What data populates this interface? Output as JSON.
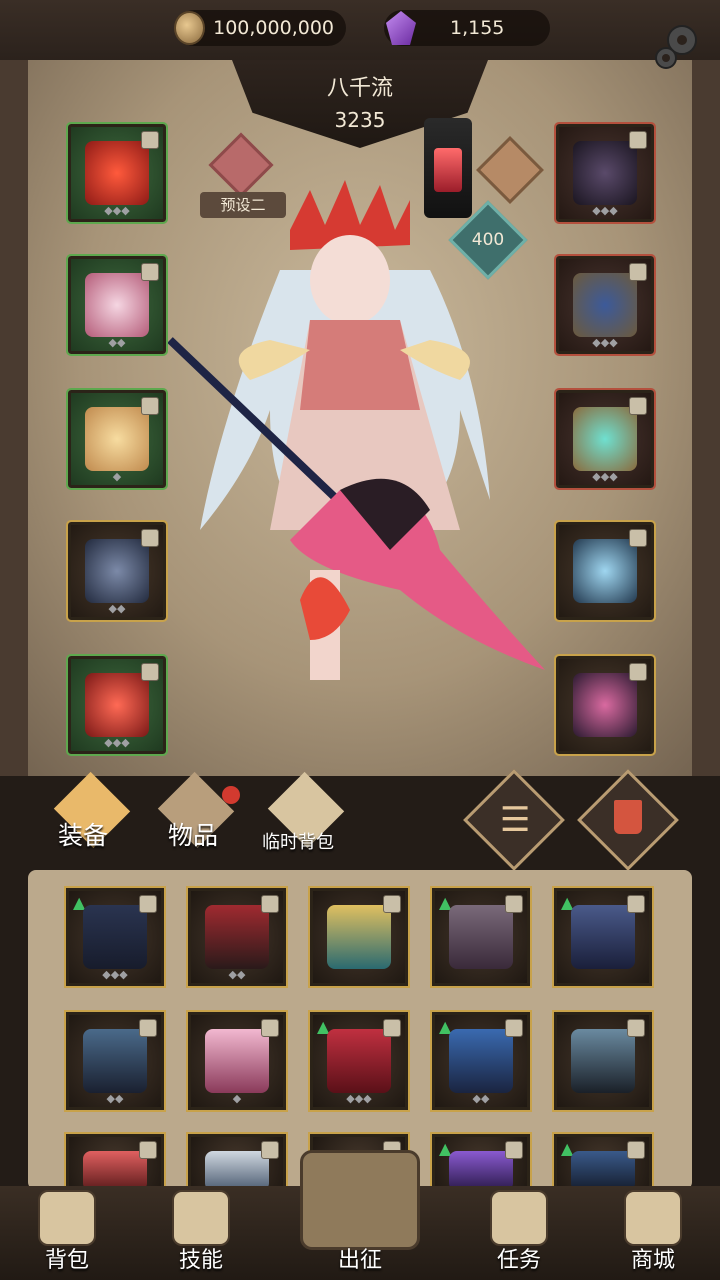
{
  "currency": {
    "gold": "100,000,000",
    "gems": "1,155"
  },
  "hero": {
    "name": "八千流",
    "power": "3235"
  },
  "preset": {
    "label": "预设二"
  },
  "badge": {
    "value": "400"
  },
  "tabs": {
    "equipment": "装备",
    "items": "物品",
    "temp_bag": "临时背包"
  },
  "nav": {
    "bag": "背包",
    "skills": "技能",
    "expedition": "出征",
    "tasks": "任务",
    "shop": "商城"
  },
  "icons": {
    "gold": "coin-icon",
    "gem": "purple-gem-icon",
    "settings": "gear-icon",
    "sort": "sort-list-icon",
    "delete": "trash-icon"
  },
  "colors": {
    "accent_gold": "#c8a24a",
    "rarity_green": "#5ea84e",
    "rarity_red": "#b4503d",
    "upgrade_arrow": "#41c163",
    "notification": "#d23a2f"
  }
}
